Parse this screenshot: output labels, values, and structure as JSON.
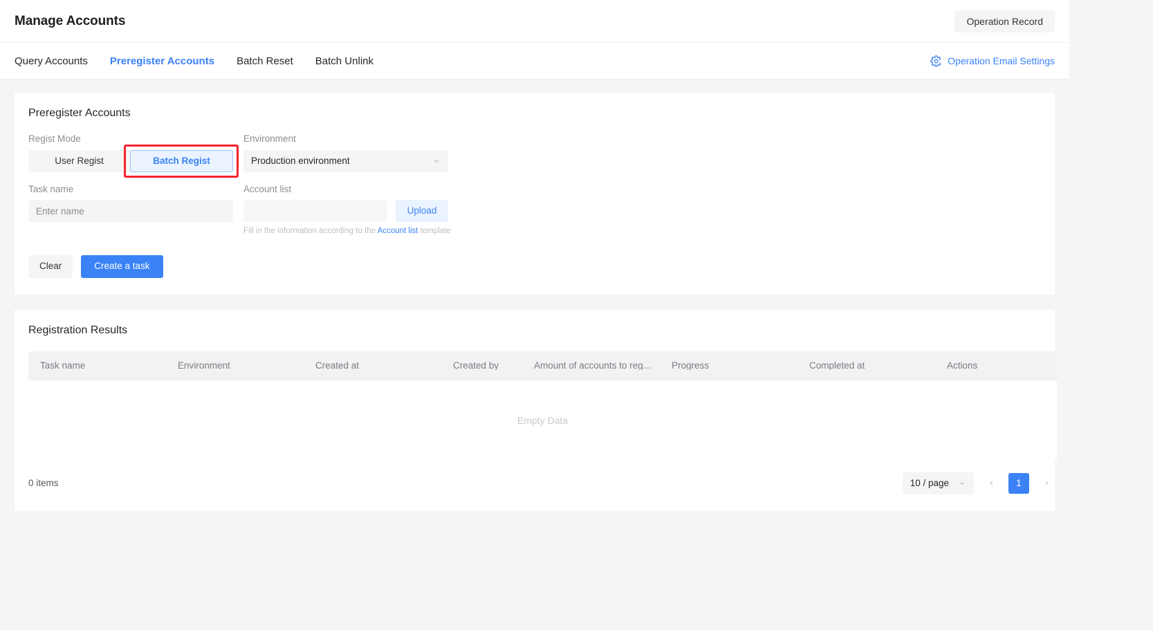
{
  "header": {
    "title": "Manage Accounts",
    "operation_record_label": "Operation Record"
  },
  "tabs": [
    {
      "label": "Query Accounts",
      "active": false
    },
    {
      "label": "Preregister Accounts",
      "active": true
    },
    {
      "label": "Batch Reset",
      "active": false
    },
    {
      "label": "Batch Unlink",
      "active": false
    }
  ],
  "email_settings": {
    "label": "Operation Email Settings",
    "icon": "gear-icon",
    "color": "#3b82f6"
  },
  "form_card": {
    "title": "Preregister Accounts",
    "regist_mode": {
      "label": "Regist Mode",
      "options": [
        "User Regist",
        "Batch Regist"
      ],
      "selected": "Batch Regist"
    },
    "environment": {
      "label": "Environment",
      "selected": "Production environment"
    },
    "task_name": {
      "label": "Task name",
      "value": "",
      "placeholder": "Enter name"
    },
    "account_list": {
      "label": "Account list",
      "value": "",
      "placeholder": "",
      "upload_label": "Upload",
      "hint_prefix": "Fill in the information according to the ",
      "hint_link": "Account list",
      "hint_suffix": " template"
    },
    "clear_label": "Clear",
    "create_label": "Create a task"
  },
  "results_card": {
    "title": "Registration Results",
    "columns": [
      "Task name",
      "Environment",
      "Created at",
      "Created by",
      "Amount of accounts to reg...",
      "Progress",
      "Completed at",
      "Actions"
    ],
    "rows": [],
    "empty_text": "Empty Data",
    "pagination": {
      "items_text": "0 items",
      "page_size_label": "10 / page",
      "current_page": "1",
      "prev_icon": "chevron-left-icon",
      "next_icon": "chevron-right-icon"
    }
  },
  "annotation": {
    "type": "highlight-box",
    "color": "#f5222d",
    "target": "Batch Regist"
  }
}
